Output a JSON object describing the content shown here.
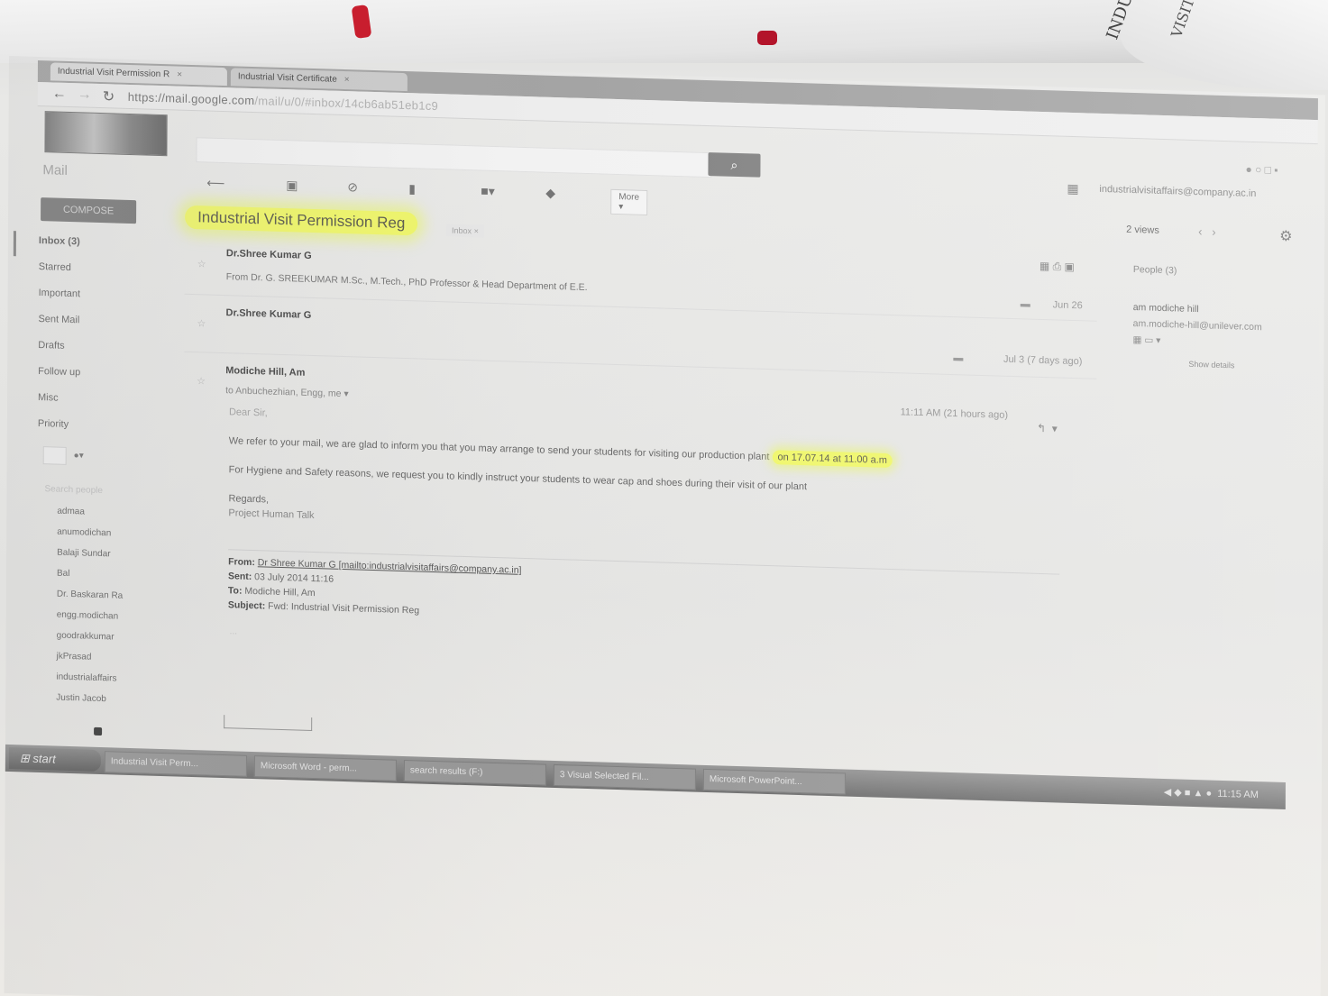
{
  "browser": {
    "tabs": [
      {
        "label": "Industrial Visit Permission R"
      },
      {
        "label": "Industrial Visit Certificate"
      }
    ],
    "url_main": "https://mail.google.com",
    "url_rest": "/mail/u/0/#inbox/14cb6ab51eb1c9"
  },
  "header": {
    "mail_label": "Mail",
    "account": "industrialvisitaffairs@company.ac.in"
  },
  "toolbar": {
    "more_label": "More"
  },
  "sidebar": {
    "compose_label": "COMPOSE",
    "folders": [
      {
        "label": "Inbox (3)"
      },
      {
        "label": "Starred"
      },
      {
        "label": "Important"
      },
      {
        "label": "Sent Mail"
      },
      {
        "label": "Drafts"
      },
      {
        "label": "Follow up"
      },
      {
        "label": "Misc"
      },
      {
        "label": "Priority"
      }
    ],
    "contacts_title": "Search people",
    "contacts": [
      {
        "name": "admaa"
      },
      {
        "name": "anumodichan"
      },
      {
        "name": "Balaji Sundar"
      },
      {
        "name": "Bal"
      },
      {
        "name": "Dr. Baskaran Ra"
      },
      {
        "name": "engg.modichan"
      },
      {
        "name": "goodrakkumar"
      },
      {
        "name": "jkPrasad"
      },
      {
        "name": "industrialaffairs"
      },
      {
        "name": "Justin Jacob"
      }
    ]
  },
  "thread": {
    "subject": "Industrial Visit Permission Reg",
    "label_chip": "Inbox",
    "messages": [
      {
        "sender": "Dr.Shree Kumar G",
        "snippet": "From Dr. G. SREEKUMAR M.Sc., M.Tech., PhD Professor & Head Department of E.E.",
        "date": "Jun 26"
      },
      {
        "sender": "Dr.Shree Kumar G",
        "snippet": "",
        "date": "Jul 3 (7 days ago)"
      },
      {
        "sender": "Modiche Hill, Am",
        "to_line": "to Anbuchezhian, Engg, me",
        "date": "11:11 AM (21 hours ago)",
        "greeting": "Dear Sir,",
        "body1": "We refer to your mail, we are glad to inform you that you may arrange to send your students for visiting our production plant",
        "body1_highlight": "on 17.07.14 at 11.00 a.m",
        "body2": "For Hygiene and Safety reasons, we request you to kindly instruct your students to wear cap and shoes during their visit of our plant",
        "regards": "Regards,",
        "signature": "Project Human Talk"
      }
    ],
    "quote": {
      "from_label": "From:",
      "from_value": "Dr Shree Kumar G [mailto:industrialvisitaffairs@company.ac.in]",
      "sent_label": "Sent:",
      "sent_value": "03 July 2014 11:16",
      "to_label": "To:",
      "to_value": "Modiche Hill, Am",
      "subject_label": "Subject:",
      "subject_value": "Fwd: Industrial Visit Permission Reg"
    },
    "ellipsis": "..."
  },
  "right_panel": {
    "count": "2 views",
    "people_label": "People (3)",
    "person_name": "am modiche hill",
    "person_email": "am.modiche-hill@unilever.com",
    "show_details": "Show details"
  },
  "taskbar": {
    "start_label": "start",
    "tasks": [
      {
        "label": "Industrial Visit Perm..."
      },
      {
        "label": "Microsoft Word - perm..."
      },
      {
        "label": "search results (F:)"
      },
      {
        "label": "3 Visual Selected Fil..."
      },
      {
        "label": "Microsoft PowerPoint..."
      }
    ],
    "tray_time": "11:15 AM"
  }
}
